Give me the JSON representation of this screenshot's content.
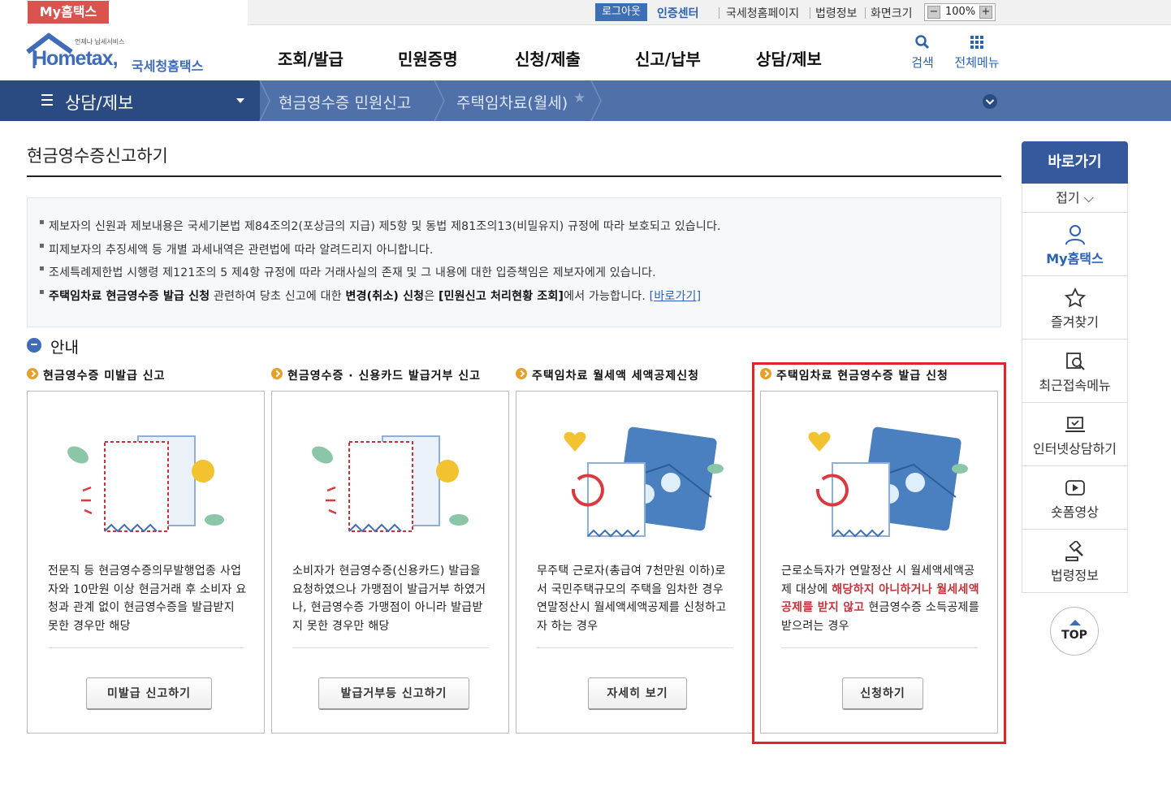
{
  "util": {
    "my_hometax": "My홈택스",
    "logout": "로그아웃",
    "cert_center": "인증센터",
    "links": [
      "국세청홈페이지",
      "법령정보",
      "화면크기"
    ],
    "zoom_minus": "−",
    "zoom_value": "100%",
    "zoom_plus": "+"
  },
  "header": {
    "logo_tagline": "언제나 납세서비스",
    "logo_text": "Hometax,",
    "logo_kor": "국세청홈택스",
    "gnb": [
      "조회/발급",
      "민원증명",
      "신청/제출",
      "신고/납부",
      "상담/제보"
    ],
    "search_label": "검색",
    "allmenu_label": "전체메뉴"
  },
  "breadcrumb": {
    "first": "상담/제보",
    "second": "현금영수증 민원신고",
    "third": "주택임차료(월세)"
  },
  "page": {
    "title": "현금영수증신고하기",
    "notices": [
      "제보자의 신원과 제보내용은 국세기본법 제84조의2(포상금의 지급) 제5항 및 동법 제81조의13(비밀유지) 규정에 따라 보호되고 있습니다.",
      "피제보자의 추징세액 등 개별 과세내역은 관련법에 따라 알려드리지 아니합니다.",
      "조세특례제한법 시행령 제121조의 5 제4항 규정에 따라 거래사실의 존재 및 그 내용에 대한 입증책임은 제보자에게 있습니다."
    ],
    "notice4_b1": "주택임차료 현금영수증 발급 신청",
    "notice4_t1": " 관련하여 당초 신고에 대한 ",
    "notice4_b2": "변경(취소) 신청",
    "notice4_t2": "은 ",
    "notice4_b3": "[민원신고 처리현황 조회]",
    "notice4_t3": "에서 가능합니다. ",
    "notice4_link": "[바로가기]",
    "guide": "안내"
  },
  "cards": [
    {
      "title": "현금영수증 미발급 신고",
      "desc": "전문직 등 현금영수증의무발행업종 사업자와 10만원 이상 현금거래 후 소비자 요청과 관계 없이 현금영수증을 발급받지 못한 경우만 해당",
      "button": "미발급 신고하기"
    },
    {
      "title": "현금영수증 · 신용카드 발급거부 신고",
      "desc": "소비자가 현금영수증(신용카드) 발급을 요청하였으나 가맹점이 발급거부 하였거나, 현금영수증 가맹점이 아니라 발급받지 못한 경우만 해당",
      "button": "발급거부등 신고하기"
    },
    {
      "title": "주택임차료 월세액 세액공제신청",
      "desc": "무주택 근로자(총급여 7천만원 이하)로서 국민주택규모의 주택을 임차한 경우 연말정산시 월세액세액공제를 신청하고자 하는 경우",
      "button": "자세히 보기"
    },
    {
      "title": "주택임차료 현금영수증 발급 신청",
      "desc_a": "근로소득자가 연말정산 시 월세액세액공제 대상에 ",
      "desc_red": "해당하지 아니하거나 월세세액공제를 받지 않고",
      "desc_b": " 현금영수증 소득공제를 받으려는 경우",
      "button": "신청하기"
    }
  ],
  "quick": {
    "header": "바로가기",
    "fold": "접기",
    "items": [
      "My홈택스",
      "즐겨찾기",
      "최근접속메뉴",
      "인터넷상담하기",
      "숏폼영상",
      "법령정보"
    ],
    "top": "TOP"
  },
  "colors": {
    "brand_blue": "#2b62b5",
    "nav_dark": "#2b4a82",
    "nav": "#4f70a8",
    "highlight": "#e0242b",
    "accent_red": "#c0343a",
    "dot_orange": "#e6a02a"
  }
}
